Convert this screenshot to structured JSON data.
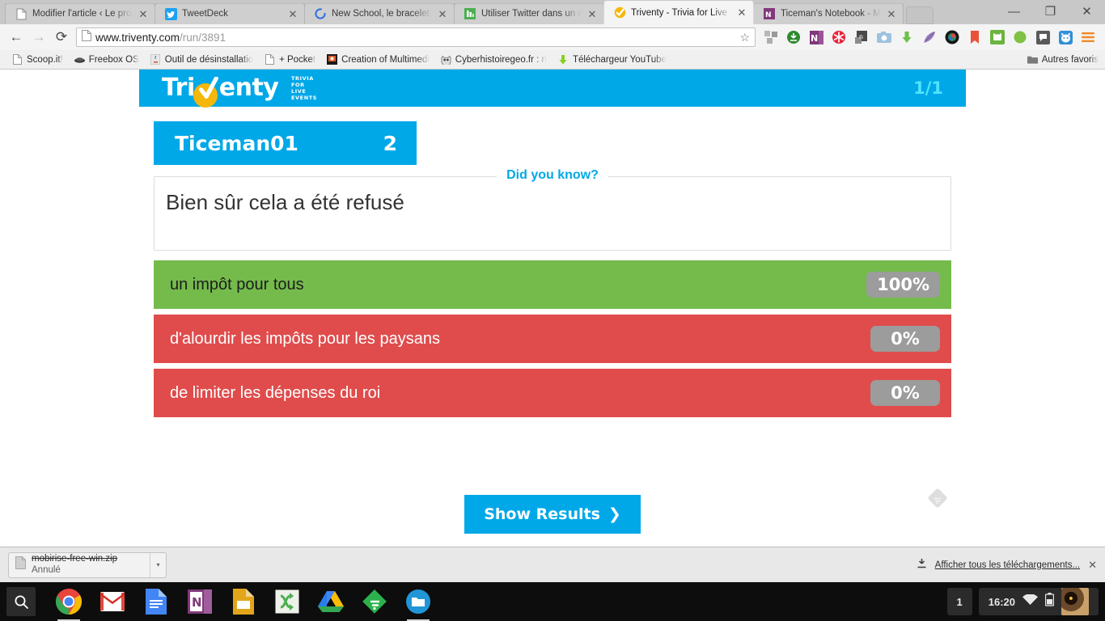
{
  "browser": {
    "tabs": [
      {
        "title": "Modifier l'article ‹ Le propu",
        "favicon": "page-icon",
        "active": false
      },
      {
        "title": "TweetDeck",
        "favicon": "twitter-icon",
        "active": false
      },
      {
        "title": "New School, le bracelet éle",
        "favicon": "circle-icon",
        "active": false
      },
      {
        "title": "Utiliser Twitter dans un co",
        "favicon": "green-doc-icon",
        "active": false
      },
      {
        "title": "Triventy - Trivia for Live Ev",
        "favicon": "triventy-check-icon",
        "active": true
      },
      {
        "title": "Ticeman's Notebook - Mic",
        "favicon": "onenote-icon",
        "active": false
      }
    ],
    "window_controls": {
      "minimize": "—",
      "maximize": "❐",
      "close": "✕"
    },
    "nav": {
      "back": "←",
      "forward": "→",
      "reload": "⟳"
    },
    "omnibox": {
      "url_host": "www.triventy.com",
      "url_path": "/run/3891",
      "page_icon": "document-icon",
      "star": "☆"
    },
    "toolbar_extensions": [
      "extensions-icon",
      "download-green-icon",
      "onenote-icon",
      "red-asterisk-icon",
      "evernote-icon",
      "camera-icon",
      "green-download-arrow-icon",
      "feather-icon",
      "lens-icon",
      "red-bookmark-icon",
      "print-icon",
      "green-dot-icon",
      "speech-bubble-icon",
      "cat-icon",
      "chrome-menu-icon"
    ],
    "bookmarks": [
      {
        "label": "Scoop.it!",
        "icon": "page-icon"
      },
      {
        "label": "Freebox OS",
        "icon": "freebox-icon"
      },
      {
        "label": "Outil de désinstallatio",
        "icon": "java-icon"
      },
      {
        "label": "+ Pocket",
        "icon": "page-icon"
      },
      {
        "label": "Creation of Multimedi",
        "icon": "multimedia-icon"
      },
      {
        "label": "Cyberhistoiregeo.fr : n",
        "icon": "owl-icon"
      },
      {
        "label": "Téléchargeur YouTube",
        "icon": "green-download-arrow-icon"
      }
    ],
    "bookmarks_other": {
      "label": "Autres favoris",
      "icon": "folder-icon"
    },
    "download_shelf": {
      "file_name": "mobirise-free-win.zip",
      "status": "Annulé",
      "file_icon": "file-icon",
      "caret": "▾",
      "show_all_label": "Afficher tous les téléchargements...",
      "show_all_icon": "download-icon",
      "close": "✕"
    }
  },
  "triventy": {
    "logo": {
      "text_before": "Tri",
      "text_after": "enty",
      "tagline": "TRIVIA FOR LIVE EVENTS",
      "check_icon": "check-icon"
    },
    "question_counter": "1/1",
    "player": {
      "name": "Ticeman01",
      "score": "2"
    },
    "did_you_know": {
      "legend": "Did you know?",
      "text": "Bien sûr cela a été refusé"
    },
    "answers": [
      {
        "label": "un impôt pour tous",
        "percent": "100%",
        "state": "correct"
      },
      {
        "label": "d'alourdir les impôts pour les paysans",
        "percent": "0%",
        "state": "wrong"
      },
      {
        "label": "de limiter les dépenses du roi",
        "percent": "0%",
        "state": "wrong"
      }
    ],
    "show_results": {
      "label": "Show Results",
      "chevron": "❯"
    },
    "feedback_icon": "feedback-diamond-icon",
    "colors": {
      "brand_blue": "#00a8e8",
      "counter_cyan": "#4fe3ff",
      "correct_green": "#74bb4c",
      "wrong_red": "#e04c4c",
      "badge_grey": "#9c9c9c",
      "logo_yellow": "#f5b70a"
    }
  },
  "taskbar": {
    "search_icon": "search-icon",
    "apps": [
      "chrome-icon",
      "gmail-icon",
      "google-docs-icon",
      "onenote-icon",
      "google-slides-icon",
      "shuffle-icon",
      "google-drive-icon",
      "feedly-icon",
      "files-icon"
    ],
    "workspace": "1",
    "time": "16:20",
    "wifi_icon": "wifi-icon",
    "battery_icon": "battery-icon",
    "avatar": "user-avatar"
  }
}
